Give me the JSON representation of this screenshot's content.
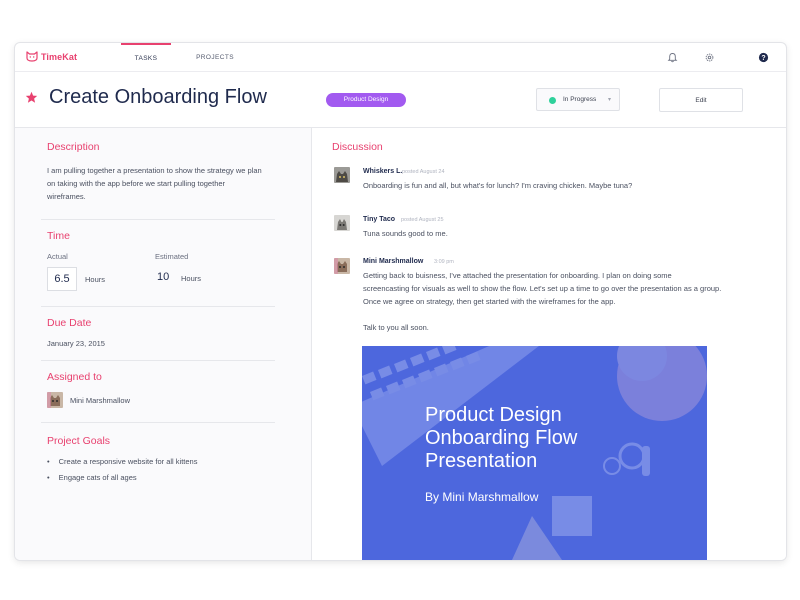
{
  "app": {
    "name": "TimeKat"
  },
  "nav": {
    "tabs": [
      {
        "label": "TASKS",
        "active": true
      },
      {
        "label": "PROJECTS",
        "active": false
      }
    ],
    "icons": [
      "bell-icon",
      "gear-icon",
      "help-icon"
    ]
  },
  "task": {
    "title": "Create Onboarding Flow",
    "tag": "Product Design",
    "status": "In Progress",
    "edit_label": "Edit"
  },
  "details": {
    "description": {
      "heading": "Description",
      "lines": [
        "I am pulling together a presentation to show the strategy we plan",
        "on taking with the app before we start pulling together",
        "wireframes."
      ]
    },
    "time": {
      "heading": "Time",
      "actual_label": "Actual",
      "actual_value": "6.5",
      "actual_unit": "Hours",
      "estimated_label": "Estimated",
      "estimated_value": "10",
      "estimated_unit": "Hours"
    },
    "due_date": {
      "heading": "Due Date",
      "value": "January 23, 2015"
    },
    "assigned": {
      "heading": "Assigned to",
      "name": "Mini Marshmallow"
    },
    "goals": {
      "heading": "Project Goals",
      "items": [
        "Create a responsive website for all kittens",
        "Engage cats of all ages"
      ]
    }
  },
  "discussion": {
    "heading": "Discussion",
    "messages": [
      {
        "author": "Whiskers L.",
        "time": "posted August 24",
        "lines": [
          "Onboarding is fun and all, but what's for lunch? I'm craving chicken. Maybe tuna?"
        ]
      },
      {
        "author": "Tiny Taco",
        "time": "posted August 25",
        "lines": [
          "Tuna sounds good to me."
        ]
      },
      {
        "author": "Mini Marshmallow",
        "time": "3:09 pm",
        "lines": [
          "Getting back to buisness, I've attached the presentation for onboarding. I plan on doing some",
          "screencasting for visuals as well to show the flow. Let's set up a time to go over the presentation as a group.",
          "Once we agree on strategy, then get started with the wireframes for the app."
        ],
        "closing": "Talk to you all soon."
      }
    ],
    "attachment": {
      "title_lines": [
        "Product Design",
        "Onboarding Flow",
        "Presentation"
      ],
      "by_prefix": "By",
      "by_name": "Mini Marshmallow"
    }
  },
  "colors": {
    "accent": "#e8416f",
    "tag": "#a25af0",
    "status": "#2fd19b",
    "navy": "#1f2a4d",
    "attachment_overlay": "#4d67dd"
  }
}
